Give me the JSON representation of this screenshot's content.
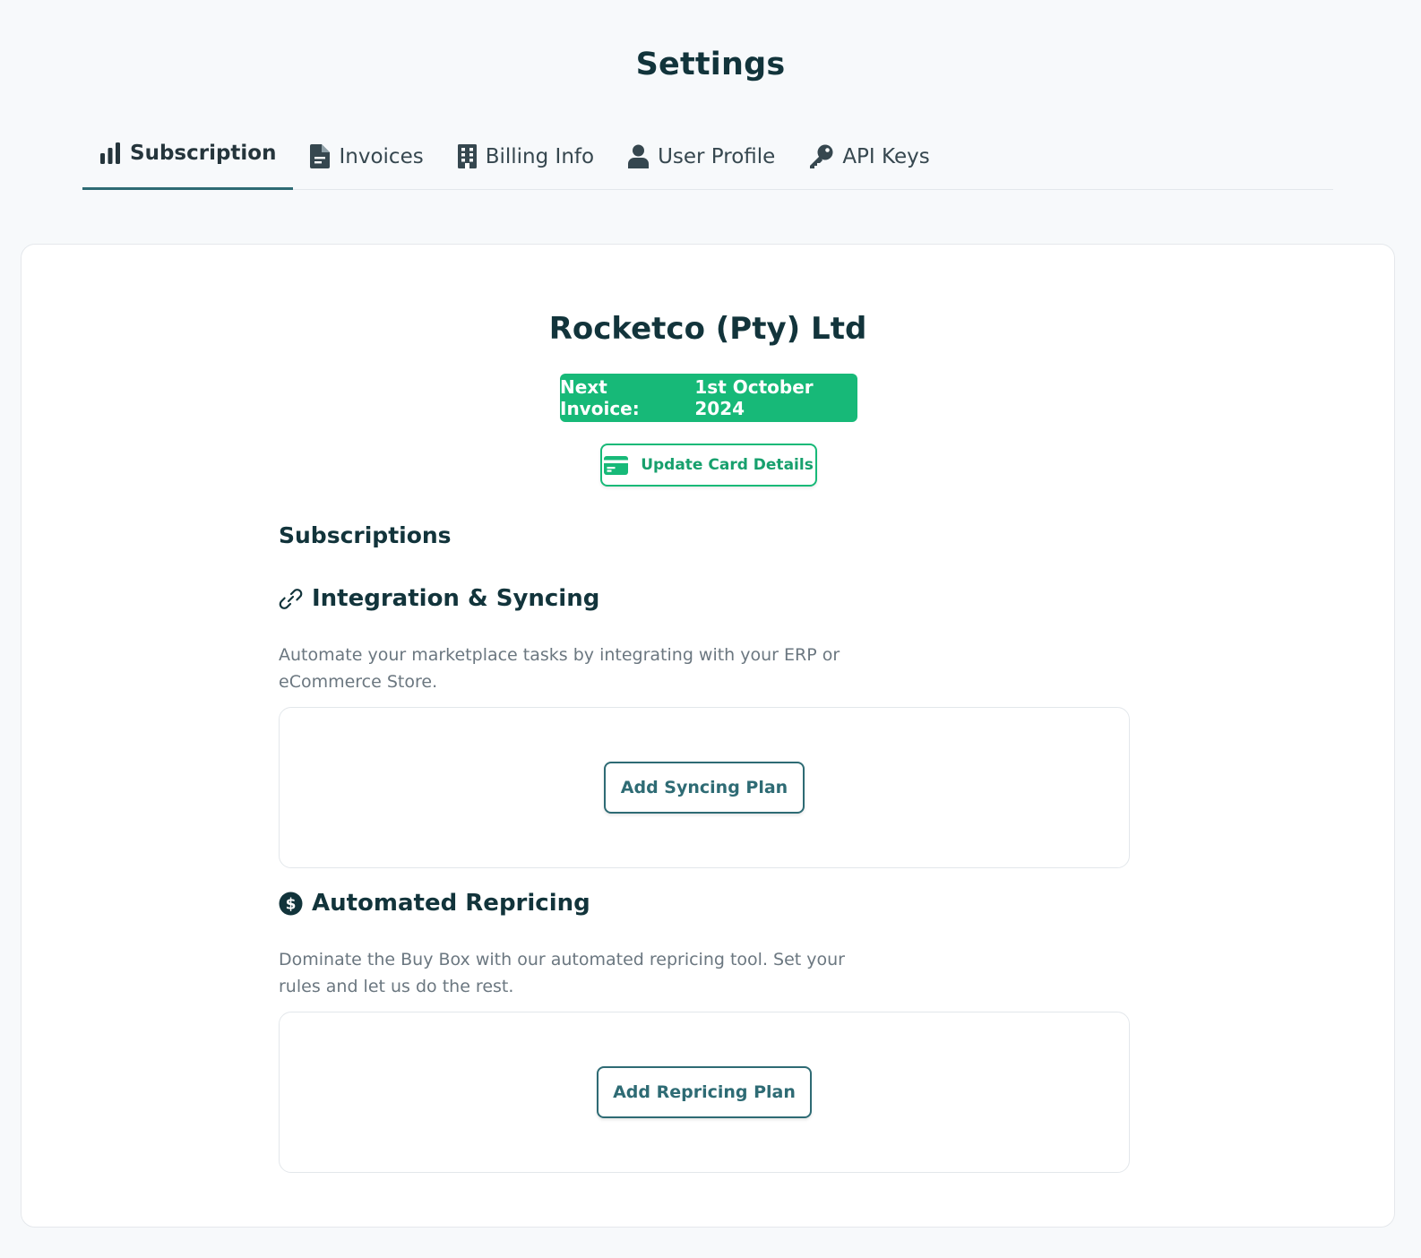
{
  "page": {
    "title": "Settings"
  },
  "tabs": [
    {
      "label": "Subscription",
      "icon": "bar-chart-icon",
      "active": true
    },
    {
      "label": "Invoices",
      "icon": "document-icon"
    },
    {
      "label": "Billing Info",
      "icon": "building-icon"
    },
    {
      "label": "User Profile",
      "icon": "user-icon"
    },
    {
      "label": "API Keys",
      "icon": "key-icon"
    }
  ],
  "account": {
    "company_name": "Rocketco (Pty) Ltd",
    "next_invoice_label": "Next Invoice:",
    "next_invoice_date": "1st October 2024",
    "update_card_label": "Update Card Details"
  },
  "subscriptions": {
    "heading": "Subscriptions",
    "items": [
      {
        "title": "Integration & Syncing",
        "icon": "link-icon",
        "description": "Automate your marketplace tasks by integrating with your ERP or eCommerce Store.",
        "button_label": "Add Syncing Plan"
      },
      {
        "title": "Automated Repricing",
        "icon": "dollar-circle-icon",
        "description": "Dominate the Buy Box with our automated repricing tool. Set your rules and let us do the rest.",
        "button_label": "Add Repricing Plan"
      }
    ]
  },
  "colors": {
    "brand_dark": "#12343b",
    "accent_green": "#17b978",
    "teal": "#2e6b74",
    "muted_text": "#6b7780",
    "page_bg": "#f7f9fb"
  }
}
